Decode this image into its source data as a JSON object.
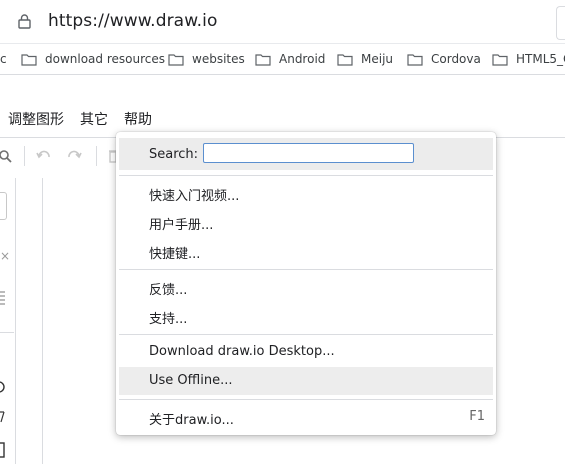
{
  "browser": {
    "url": "https://www.draw.io",
    "bookmarks": [
      {
        "label": "c",
        "hasIcon": false
      },
      {
        "label": "download resources",
        "hasIcon": true
      },
      {
        "label": "websites",
        "hasIcon": true
      },
      {
        "label": "Android",
        "hasIcon": true
      },
      {
        "label": "Meiju",
        "hasIcon": true
      },
      {
        "label": "Cordova",
        "hasIcon": true
      },
      {
        "label": "HTML5_C",
        "hasIcon": true
      }
    ]
  },
  "menubar": {
    "items": [
      "调整图形",
      "其它",
      "帮助"
    ]
  },
  "help_menu": {
    "search_label": "Search:",
    "search_value": "",
    "items": [
      {
        "label": "快速入门视频...",
        "shortcut": ""
      },
      {
        "label": "用户手册...",
        "shortcut": ""
      },
      {
        "label": "快捷键...",
        "shortcut": ""
      },
      {
        "label": "反馈...",
        "shortcut": ""
      },
      {
        "label": "支持...",
        "shortcut": ""
      },
      {
        "label": "Download draw.io Desktop...",
        "shortcut": ""
      },
      {
        "label": "Use Offline...",
        "shortcut": ""
      },
      {
        "label": "关于draw.io...",
        "shortcut": "F1"
      }
    ],
    "highlighted_item": "Use Offline..."
  },
  "colors": {
    "menu_highlight": "#ededed",
    "input_border": "#5b8fcf",
    "separator": "#dadce0"
  }
}
